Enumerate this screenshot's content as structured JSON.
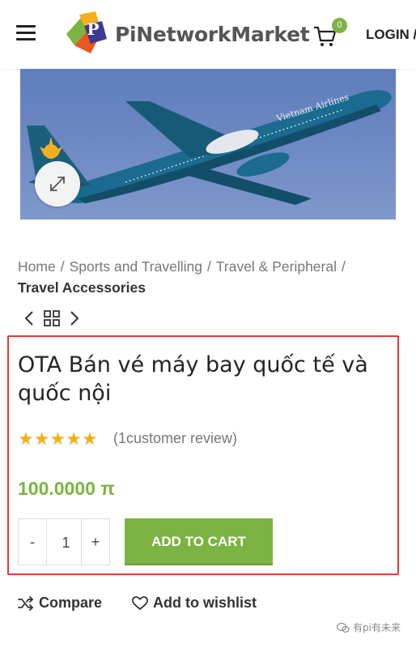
{
  "header": {
    "logo_text": "PiNetworkMarket",
    "cart_count": "0",
    "login_label": "LOGIN /"
  },
  "breadcrumb": {
    "items": [
      "Home",
      "Sports and Travelling",
      "Travel & Peripheral"
    ],
    "current": "Travel Accessories"
  },
  "hero": {
    "airline_text": "Vietnam Airlines"
  },
  "product": {
    "title": "OTA Bán vé máy bay quốc tế và quốc nội",
    "rating": 5,
    "rating_max": 5,
    "review_text": "(1customer review)",
    "price": "100.0000 π",
    "quantity": "1",
    "minus_label": "-",
    "plus_label": "+",
    "add_to_cart_label": "ADD TO CART"
  },
  "actions": {
    "compare_label": "Compare",
    "wishlist_label": "Add to wishlist"
  },
  "watermark": "有pi有未来",
  "colors": {
    "accent_green": "#7cb342",
    "highlight_red": "#e53935",
    "star_gold": "#f2b01e",
    "sky_blue": "#6c88c2"
  },
  "icons": [
    "hamburger-icon",
    "cart-icon",
    "zoom-expand-icon",
    "chevron-left-icon",
    "grid-icon",
    "chevron-right-icon",
    "star-icon",
    "shuffle-icon",
    "heart-icon",
    "wechat-icon"
  ]
}
